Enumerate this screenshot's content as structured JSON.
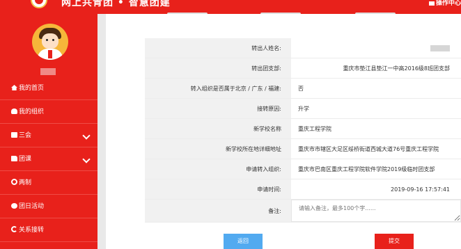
{
  "header": {
    "brand": "网上共青团 • 智慧团建",
    "right_label": "操作中心",
    "ghost_tabs": [
      "",
      "",
      ""
    ]
  },
  "sidebar": {
    "user_name": "",
    "items": [
      {
        "label": "我的首页",
        "icon": "home-icon",
        "expandable": false
      },
      {
        "label": "我的组织",
        "icon": "org-icon",
        "expandable": false
      },
      {
        "label": "三会",
        "icon": "doc-icon",
        "expandable": true
      },
      {
        "label": "团课",
        "icon": "folder-icon",
        "expandable": true
      },
      {
        "label": "两制",
        "icon": "circle-icon",
        "expandable": false
      },
      {
        "label": "团日活动",
        "icon": "gear-icon",
        "expandable": false
      },
      {
        "label": "关系接转",
        "icon": "sync-icon",
        "expandable": false
      }
    ]
  },
  "form": {
    "rows": [
      {
        "label": "转出人姓名:",
        "value": "",
        "required": false
      },
      {
        "label": "转出团支部:",
        "value": "重庆市垫江县垫江一中高2016级8班团支部",
        "required": false
      },
      {
        "label": "转入组织是否属于北京 / 广东 / 福建:",
        "value": "否",
        "required": true
      },
      {
        "label": "接转原因:",
        "value": "升学",
        "required": true
      },
      {
        "label": "新学校名称",
        "value": "重庆工程学院",
        "required": true
      },
      {
        "label": "新学校所在地详细地址",
        "value": "重庆市市辖区大足区绥桥街道西城大道76号重庆工程学院",
        "required": false
      },
      {
        "label": "申请转入组织:",
        "value": "重庆市巴南区重庆工程学院软件学院2019级临时团支部",
        "required": true
      },
      {
        "label": "申请时间:",
        "value": "2019-09-16 17:57:41",
        "required": false
      }
    ],
    "note": {
      "label": "备注:",
      "placeholder": "请输入备注，最多100个字......"
    }
  },
  "buttons": {
    "back": "返回",
    "submit": "提交"
  },
  "colors": {
    "primary": "#e8211b",
    "secondary": "#52aaf0"
  }
}
